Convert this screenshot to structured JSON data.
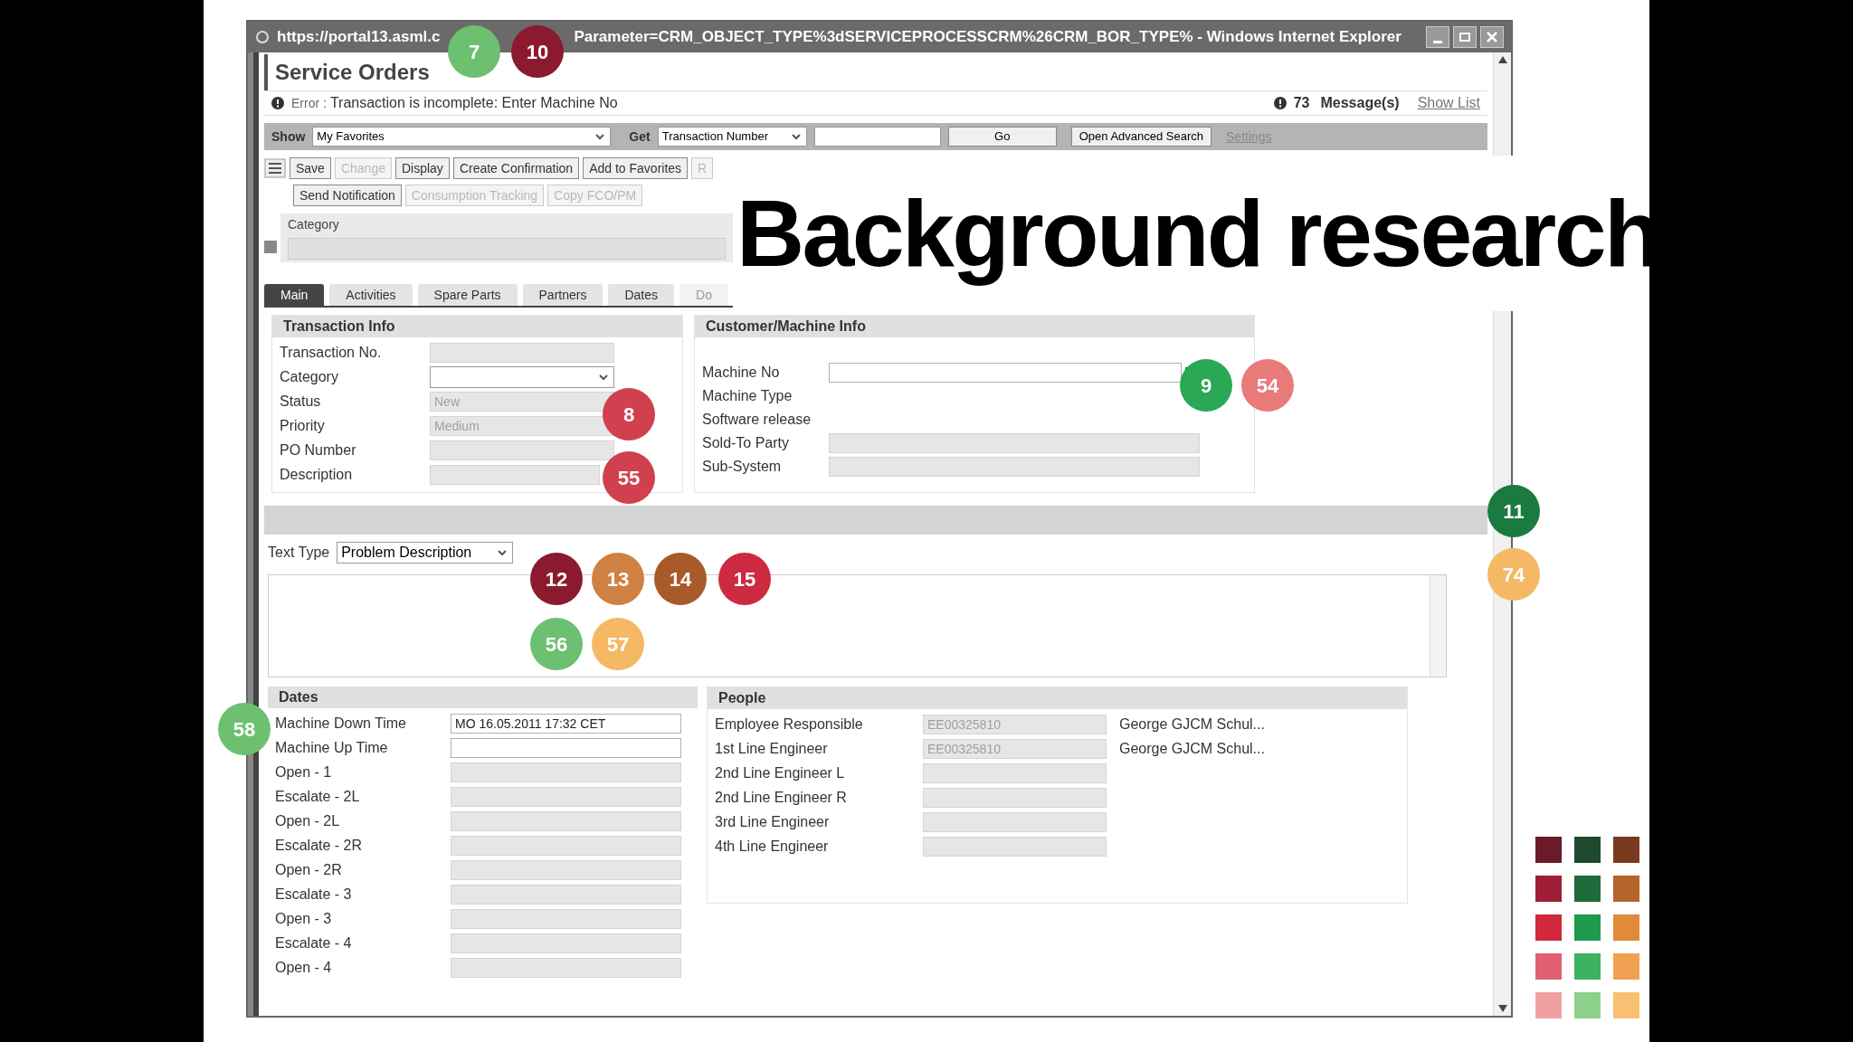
{
  "window": {
    "title_start": "https://portal13.asml.c",
    "title_end": "Parameter=CRM_OBJECT_TYPE%3dSERVICEPROCESSCRM%26CRM_BOR_TYPE% - Windows Internet Explorer"
  },
  "page": {
    "title": "Service Orders",
    "error_label": "Error :",
    "error_text": "Transaction is incomplete: Enter Machine No",
    "message_count": "73",
    "message_label": "Message(s)",
    "message_link": "Show List"
  },
  "search_bar": {
    "show_label": "Show",
    "show_value": "My Favorites",
    "get_label": "Get",
    "get_value": "Transaction Number",
    "go": "Go",
    "advanced": "Open Advanced Search",
    "settings": "Settings"
  },
  "toolbar_rows": [
    {
      "buttons": [
        {
          "label": "Save",
          "disabled": false
        },
        {
          "label": "Change",
          "disabled": true
        },
        {
          "label": "Display",
          "disabled": false
        },
        {
          "label": "Create Confirmation",
          "disabled": false
        },
        {
          "label": "Add to Favorites",
          "disabled": false
        },
        {
          "label": "R",
          "disabled": true
        }
      ]
    },
    {
      "buttons": [
        {
          "label": "Send Notification",
          "disabled": false
        },
        {
          "label": "Consumption Tracking",
          "disabled": true
        },
        {
          "label": "Copy FCO/PM",
          "disabled": true
        }
      ]
    }
  ],
  "category": {
    "label": "Category"
  },
  "tabs": [
    {
      "label": "Main",
      "selected": true,
      "disabled": false
    },
    {
      "label": "Activities",
      "selected": false,
      "disabled": false
    },
    {
      "label": "Spare Parts",
      "selected": false,
      "disabled": false
    },
    {
      "label": "Partners",
      "selected": false,
      "disabled": false
    },
    {
      "label": "Dates",
      "selected": false,
      "disabled": false
    },
    {
      "label": "Do",
      "selected": false,
      "disabled": true
    }
  ],
  "transaction_info": {
    "title": "Transaction Info",
    "fields": [
      {
        "label": "Transaction No.",
        "kind": "input",
        "disabled": true
      },
      {
        "label": "Category",
        "kind": "select",
        "disabled": false
      },
      {
        "label": "Status",
        "kind": "input",
        "disabled": true,
        "value": "New"
      },
      {
        "label": "Priority",
        "kind": "input",
        "disabled": true,
        "value": "Medium"
      },
      {
        "label": "PO Number",
        "kind": "input",
        "disabled": true
      },
      {
        "label": "Description",
        "kind": "input",
        "disabled": true
      }
    ]
  },
  "customer_info": {
    "title": "Customer/Machine Info",
    "fields": [
      {
        "label": "Machine No",
        "kind": "input",
        "disabled": false
      },
      {
        "label": "Machine Type",
        "kind": "none"
      },
      {
        "label": "Software release",
        "kind": "none"
      },
      {
        "label": "Sold-To Party",
        "kind": "input",
        "disabled": true
      },
      {
        "label": "Sub-System",
        "kind": "input",
        "disabled": true
      }
    ]
  },
  "text_type": {
    "label": "Text Type",
    "value": "Problem Description"
  },
  "dates": {
    "title": "Dates",
    "fields": [
      {
        "label": "Machine Down Time",
        "disabled": false,
        "value": "MO 16.05.2011 17:32 CET"
      },
      {
        "label": "Machine Up Time",
        "disabled": false
      },
      {
        "label": "Open - 1",
        "disabled": true
      },
      {
        "label": "Escalate - 2L",
        "disabled": true
      },
      {
        "label": "Open - 2L",
        "disabled": true
      },
      {
        "label": "Escalate - 2R",
        "disabled": true
      },
      {
        "label": "Open - 2R",
        "disabled": true
      },
      {
        "label": "Escalate - 3",
        "disabled": true
      },
      {
        "label": "Open - 3",
        "disabled": true
      },
      {
        "label": "Escalate - 4",
        "disabled": true
      },
      {
        "label": "Open - 4",
        "disabled": true
      }
    ]
  },
  "people": {
    "title": "People",
    "rows": [
      {
        "label": "Employee Responsible",
        "value": "EE00325810",
        "name": "George GJCM Schul..."
      },
      {
        "label": "1st Line Engineer",
        "value": "EE00325810",
        "name": "George GJCM Schul..."
      },
      {
        "label": "2nd Line Engineer L"
      },
      {
        "label": "2nd Line Engineer R"
      },
      {
        "label": "3rd Line Engineer"
      },
      {
        "label": "4th Line Engineer"
      }
    ]
  },
  "slide": {
    "heading": "Background research"
  },
  "badges": [
    {
      "number": "7",
      "color": "#6cc070"
    },
    {
      "number": "10",
      "color": "#8b1a2e"
    },
    {
      "number": "9",
      "color": "#2aa855"
    },
    {
      "number": "54",
      "color": "#e87a7a"
    },
    {
      "number": "8",
      "color": "#d0404f"
    },
    {
      "number": "55",
      "color": "#d0404f"
    },
    {
      "number": "11",
      "color": "#1a7a40"
    },
    {
      "number": "12",
      "color": "#8b1a2e"
    },
    {
      "number": "13",
      "color": "#d08040"
    },
    {
      "number": "14",
      "color": "#a85a2a"
    },
    {
      "number": "15",
      "color": "#cc2a40"
    },
    {
      "number": "74",
      "color": "#f5b865"
    },
    {
      "number": "56",
      "color": "#6cc070"
    },
    {
      "number": "57",
      "color": "#f5b865"
    },
    {
      "number": "58",
      "color": "#6cc070"
    }
  ],
  "palette": [
    {
      "color": "#6b1a2a"
    },
    {
      "color": "#1e4a30"
    },
    {
      "color": "#7a3a20"
    },
    {
      "color": "#9e1f35"
    },
    {
      "color": "#1f6b3c"
    },
    {
      "color": "#b5642a"
    },
    {
      "color": "#d0283c"
    },
    {
      "color": "#1e9a4c"
    },
    {
      "color": "#e08a3a"
    },
    {
      "color": "#e06070"
    },
    {
      "color": "#3cb25e"
    },
    {
      "color": "#f0a050"
    },
    {
      "color": "#f0a0a0"
    },
    {
      "color": "#8cd08c"
    },
    {
      "color": "#f8c070"
    }
  ]
}
